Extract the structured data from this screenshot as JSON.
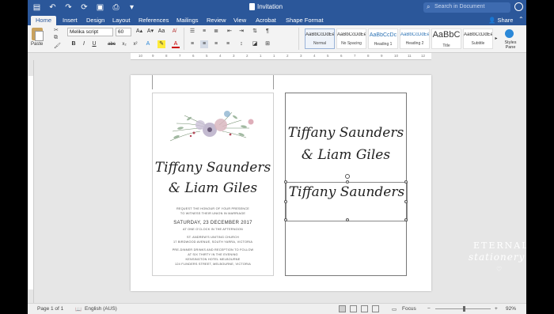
{
  "window": {
    "title": "Invitation"
  },
  "search": {
    "placeholder": "Search in Document"
  },
  "tabs": [
    "Home",
    "Insert",
    "Design",
    "Layout",
    "References",
    "Mailings",
    "Review",
    "View",
    "Acrobat",
    "Shape Format"
  ],
  "share_label": "Share",
  "ribbon": {
    "paste_label": "Paste",
    "font_name": "Melika script",
    "font_size": "60",
    "styles": [
      {
        "sample": "AaBbCcDdEe",
        "name": "Normal"
      },
      {
        "sample": "AaBbCcDdEe",
        "name": "No Spacing"
      },
      {
        "sample": "AaBbCcDc",
        "name": "Heading 1"
      },
      {
        "sample": "AaBbCcDdEe",
        "name": "Heading 2"
      },
      {
        "sample": "AaBbC",
        "name": "Title"
      },
      {
        "sample": "AaBbCcDdEe",
        "name": "Subtitle"
      }
    ],
    "styles_pane_label": "Styles Pane"
  },
  "ruler": {
    "ticks": [
      "10",
      "9",
      "8",
      "7",
      "6",
      "5",
      "4",
      "3",
      "2",
      "1",
      "1",
      "2",
      "3",
      "4",
      "5",
      "6",
      "7",
      "8",
      "9",
      "10",
      "11",
      "12"
    ]
  },
  "front_card": {
    "name_line1": "Tiffany Saunders",
    "name_line2": "& Liam Giles",
    "request_line1": "REQUEST THE HONOUR OF YOUR PRESENCE",
    "request_line2": "TO WITNESS THEIR UNION IN MARRIAGE",
    "date": "SATURDAY, 23 DECEMBER 2017",
    "time": "AT ONE O'CLOCK IN THE AFTERNOON",
    "venue_line1": "ST. ANDREW'S UNITING CHURCH",
    "venue_line2": "17 BIRDWOOD AVENUE, SOUTH YARRA, VICTORIA",
    "reception_line1": "PRE-DINNER DRINKS AND RECEPTION TO FOLLOW",
    "reception_line2": "AT SIX THIRTY IN THE EVENING",
    "reception_line3": "KENSINGTON HOTEL MELBOURNE",
    "reception_line4": "124 FLINDERS STREET, MELBOURNE, VICTORIA"
  },
  "back_card": {
    "name_line1": "Tiffany Saunders",
    "name_line2": "& Liam Giles",
    "selected_text": "Tiffany Saunders"
  },
  "watermark": {
    "line1": "ETERNAL",
    "line2": "stationery"
  },
  "status": {
    "page": "Page 1 of 1",
    "language": "English (AUS)",
    "focus": "Focus",
    "zoom": "92%"
  }
}
